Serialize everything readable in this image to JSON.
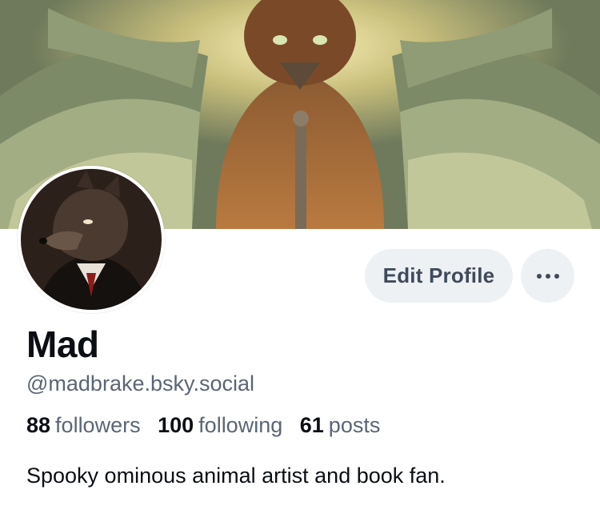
{
  "banner": {
    "image": "owl-creature-artwork-banner"
  },
  "avatar": {
    "image": "wolf-in-suit-portrait"
  },
  "actions": {
    "edit_profile_label": "Edit Profile",
    "more_icon": "ellipsis-icon"
  },
  "profile": {
    "display_name": "Mad",
    "handle": "@madbrake.bsky.social",
    "bio": "Spooky ominous animal artist and book fan."
  },
  "stats": {
    "followers_count": "88",
    "followers_label": "followers",
    "following_count": "100",
    "following_label": "following",
    "posts_count": "61",
    "posts_label": "posts"
  },
  "colors": {
    "button_bg": "#eef1f4",
    "button_text": "#3f4b5c",
    "secondary_text": "#5a6675",
    "primary_text": "#0b0f14"
  }
}
